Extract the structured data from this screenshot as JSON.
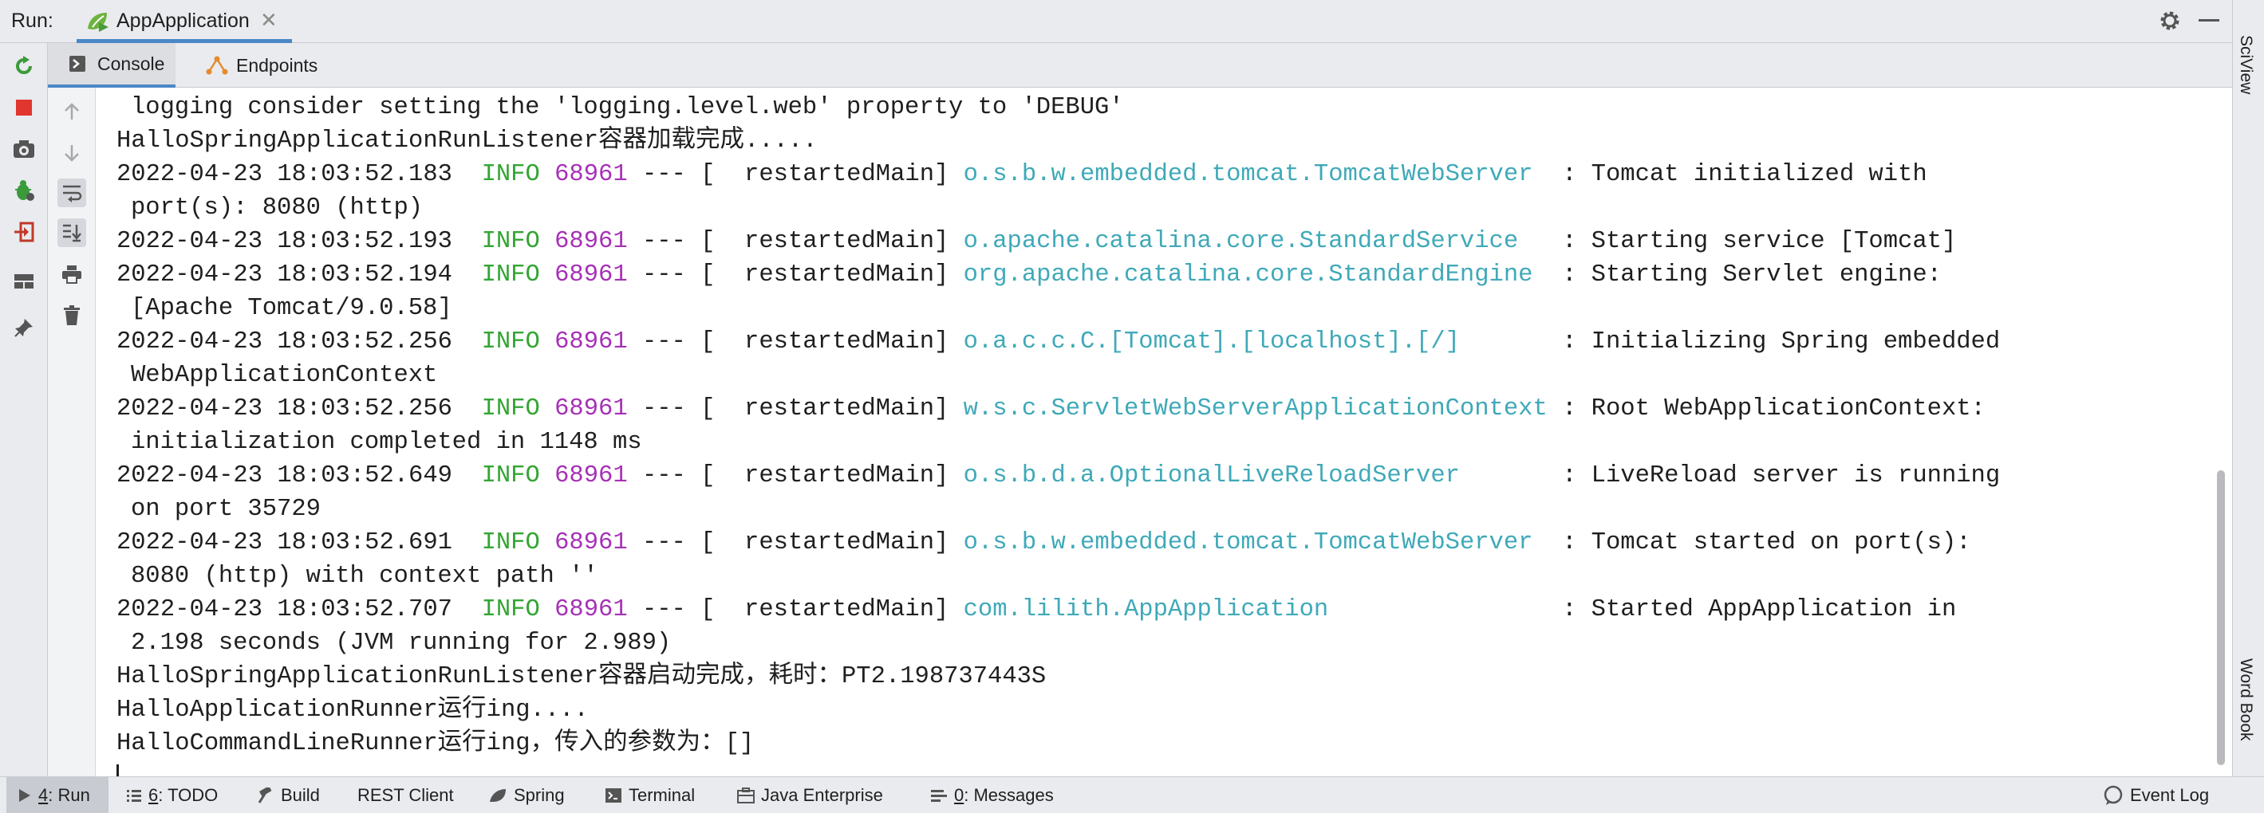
{
  "run_bar": {
    "label": "Run:",
    "tab_label": "AppApplication",
    "close_glyph": "✕"
  },
  "side_strip": {
    "top_label": "SciView",
    "bottom_label": "Word Book"
  },
  "sub_tabs": [
    {
      "label": "Console",
      "icon": "console-icon",
      "active": true
    },
    {
      "label": "Endpoints",
      "icon": "endpoints-icon",
      "active": false
    }
  ],
  "console_lines": [
    {
      "indent": true,
      "plain": "logging consider setting the 'logging.level.web' property to 'DEBUG'"
    },
    {
      "indent": false,
      "plain": "HalloSpringApplicationRunListener容器加载完成....."
    },
    {
      "indent": false,
      "ts": "2022-04-23 18:03:52.183",
      "level": "INFO",
      "pid": "68961",
      "sep": "--- [",
      "thread": "  restartedMain]",
      "logger": "o.s.b.w.embedded.tomcat.TomcatWebServer ",
      "msg": ": Tomcat initialized with"
    },
    {
      "indent": true,
      "plain": "port(s): 8080 (http)"
    },
    {
      "indent": false,
      "ts": "2022-04-23 18:03:52.193",
      "level": "INFO",
      "pid": "68961",
      "sep": "--- [",
      "thread": "  restartedMain]",
      "logger": "o.apache.catalina.core.StandardService  ",
      "msg": ": Starting service [Tomcat]"
    },
    {
      "indent": false,
      "ts": "2022-04-23 18:03:52.194",
      "level": "INFO",
      "pid": "68961",
      "sep": "--- [",
      "thread": "  restartedMain]",
      "logger": "org.apache.catalina.core.StandardEngine ",
      "msg": ": Starting Servlet engine:"
    },
    {
      "indent": true,
      "plain": "[Apache Tomcat/9.0.58]"
    },
    {
      "indent": false,
      "ts": "2022-04-23 18:03:52.256",
      "level": "INFO",
      "pid": "68961",
      "sep": "--- [",
      "thread": "  restartedMain]",
      "logger": "o.a.c.c.C.[Tomcat].[localhost].[/]      ",
      "msg": ": Initializing Spring embedded"
    },
    {
      "indent": true,
      "plain": "WebApplicationContext"
    },
    {
      "indent": false,
      "ts": "2022-04-23 18:03:52.256",
      "level": "INFO",
      "pid": "68961",
      "sep": "--- [",
      "thread": "  restartedMain]",
      "logger": "w.s.c.ServletWebServerApplicationContext",
      "msg": ": Root WebApplicationContext:"
    },
    {
      "indent": true,
      "plain": "initialization completed in 1148 ms"
    },
    {
      "indent": false,
      "ts": "2022-04-23 18:03:52.649",
      "level": "INFO",
      "pid": "68961",
      "sep": "--- [",
      "thread": "  restartedMain]",
      "logger": "o.s.b.d.a.OptionalLiveReloadServer      ",
      "msg": ": LiveReload server is running"
    },
    {
      "indent": true,
      "plain": "on port 35729"
    },
    {
      "indent": false,
      "ts": "2022-04-23 18:03:52.691",
      "level": "INFO",
      "pid": "68961",
      "sep": "--- [",
      "thread": "  restartedMain]",
      "logger": "o.s.b.w.embedded.tomcat.TomcatWebServer ",
      "msg": ": Tomcat started on port(s):"
    },
    {
      "indent": true,
      "plain": "8080 (http) with context path ''"
    },
    {
      "indent": false,
      "ts": "2022-04-23 18:03:52.707",
      "level": "INFO",
      "pid": "68961",
      "sep": "--- [",
      "thread": "  restartedMain]",
      "logger": "com.lilith.AppApplication               ",
      "msg": ": Started AppApplication in"
    },
    {
      "indent": true,
      "plain": "2.198 seconds (JVM running for 2.989)"
    },
    {
      "indent": false,
      "plain": "HalloSpringApplicationRunListener容器启动完成，耗时：PT2.198737443S"
    },
    {
      "indent": false,
      "plain": "HalloApplicationRunner运行ing...."
    },
    {
      "indent": false,
      "plain": "HalloCommandLineRunner运行ing，传入的参数为：[]"
    }
  ],
  "status_bar": {
    "tools": [
      {
        "key": "run",
        "num": "4",
        "label": ": Run",
        "active": true,
        "icon": "run-icon"
      },
      {
        "key": "todo",
        "num": "6",
        "label": ": TODO",
        "active": false,
        "icon": "list-icon"
      },
      {
        "key": "build",
        "num": "",
        "label": "Build",
        "active": false,
        "icon": "hammer-icon"
      },
      {
        "key": "rest",
        "num": "",
        "label": "REST Client",
        "active": false,
        "icon": ""
      },
      {
        "key": "spring",
        "num": "",
        "label": "Spring",
        "active": false,
        "icon": "spring-leaf-icon"
      },
      {
        "key": "terminal",
        "num": "",
        "label": "Terminal",
        "active": false,
        "icon": "terminal-icon"
      },
      {
        "key": "java",
        "num": "",
        "label": "Java Enterprise",
        "active": false,
        "icon": "java-enterprise-icon"
      },
      {
        "key": "messages",
        "num": "0",
        "label": ": Messages",
        "active": false,
        "icon": "messages-icon"
      }
    ],
    "event_log": "Event Log"
  },
  "colors": {
    "level": "#34a534",
    "pid": "#a631b6",
    "logger": "#3fa9b8",
    "accent": "#4a88c7"
  }
}
